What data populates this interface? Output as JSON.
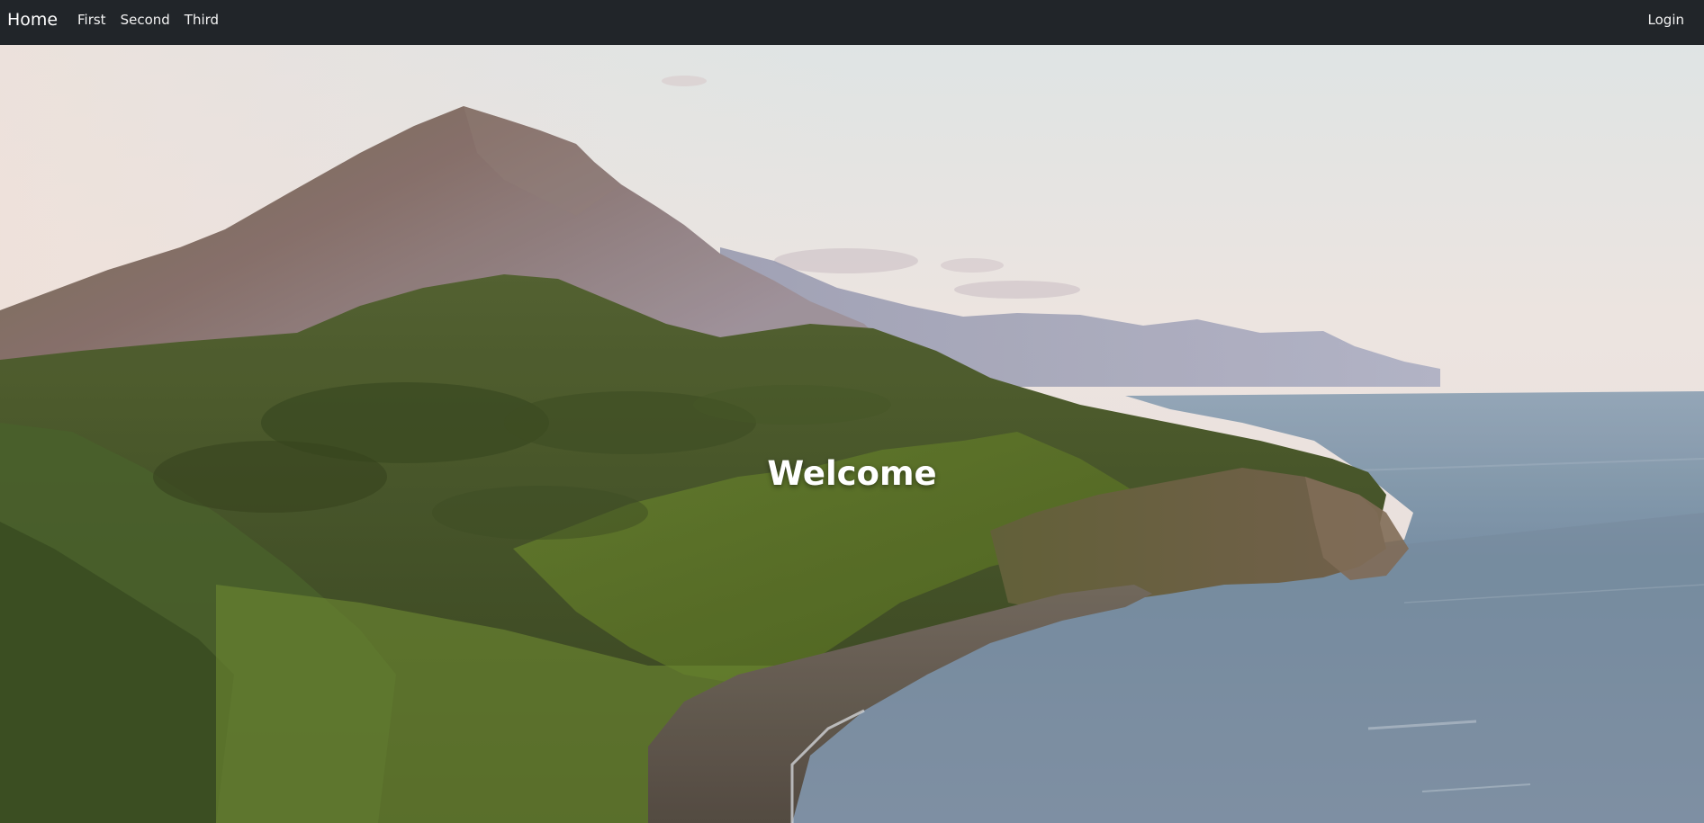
{
  "navbar": {
    "brand": "Home",
    "links": [
      {
        "label": "First"
      },
      {
        "label": "Second"
      },
      {
        "label": "Third"
      }
    ],
    "login_label": "Login",
    "background": "#212529"
  },
  "hero": {
    "title": "Welcome",
    "image_semantic": "landscape-photo"
  }
}
